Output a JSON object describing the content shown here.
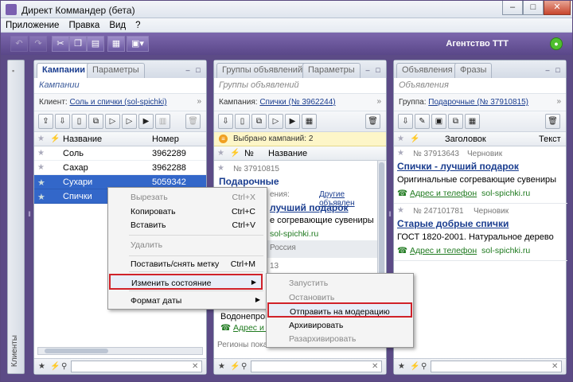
{
  "window": {
    "title": "Директ Коммандер (бета)"
  },
  "menu": [
    "Приложение",
    "Правка",
    "Вид",
    "?"
  ],
  "toolbar": {
    "agency": "Агентство ТТТ"
  },
  "side_strip": {
    "label": "Клиенты"
  },
  "panel1": {
    "tabs": [
      "Кампании",
      "Параметры"
    ],
    "subtitle": "Кампании",
    "filter_label": "Клиент:",
    "filter_value": "Соль и спички (sol-spichki)",
    "columns": [
      "Название",
      "Номер"
    ],
    "rows": [
      {
        "name": "Соль",
        "number": "3962289",
        "selected": false
      },
      {
        "name": "Сахар",
        "number": "3962288",
        "selected": false
      },
      {
        "name": "Сухари",
        "number": "5059342",
        "selected": true
      },
      {
        "name": "Спички",
        "number": "3962244",
        "selected": true
      }
    ]
  },
  "panel2": {
    "tabs": [
      "Группы объявлений",
      "Параметры"
    ],
    "subtitle": "Группы объявлений",
    "filter_label": "Кампания:",
    "filter_value": "Спички (№ 3962244)",
    "warning": "Выбрано кампаний: 2",
    "columns": [
      "№",
      "Название"
    ],
    "group_id": "№ 37910815",
    "group_name": "Подарочные",
    "hidden_partial": "ения:",
    "other_ads": "Другие объявлен",
    "ad_title_partial": "лучший подарок",
    "ad_text_partial": "е согревающие сувениры",
    "ad_url": "sol-spichki.ru",
    "region_partial": "Россия",
    "num_partial": "13",
    "text_partial": "Водонепрон",
    "contact_partial": "Адрес и те",
    "regions_partial": "Регионы показа"
  },
  "panel3": {
    "tabs": [
      "Объявления",
      "Фразы"
    ],
    "subtitle": "Объявления",
    "filter_label": "Группа:",
    "filter_value": "Подарочные (№ 37910815)",
    "columns": [
      "Заголовок",
      "Текст"
    ],
    "ads": [
      {
        "id": "№ 37913643",
        "status": "Черновик",
        "title": "Спички - лучший подарок",
        "text": "Оригинальные согревающие сувениры",
        "contact": "Адрес и телефон",
        "url": "sol-spichki.ru"
      },
      {
        "id": "№ 247101781",
        "status": "Черновик",
        "title": "Старые добрые спички",
        "text": "ГОСТ 1820-2001. Натуральное дерево",
        "contact": "Адрес и телефон",
        "url": "sol-spichki.ru"
      }
    ]
  },
  "context_menu": {
    "items": [
      {
        "label": "Вырезать",
        "shortcut": "Ctrl+X",
        "disabled": true
      },
      {
        "label": "Копировать",
        "shortcut": "Ctrl+C",
        "disabled": false
      },
      {
        "label": "Вставить",
        "shortcut": "Ctrl+V",
        "disabled": false
      },
      {
        "label": "Удалить",
        "shortcut": "",
        "disabled": true
      },
      {
        "label": "Поставить/снять метку",
        "shortcut": "Ctrl+M",
        "disabled": false
      },
      {
        "label": "Изменить состояние",
        "shortcut": "",
        "disabled": false,
        "highlighted": true
      },
      {
        "label": "Формат даты",
        "shortcut": "",
        "disabled": false
      }
    ]
  },
  "submenu": {
    "items": [
      {
        "label": "Запустить",
        "disabled": true
      },
      {
        "label": "Остановить",
        "disabled": true
      },
      {
        "label": "Отправить на модерацию",
        "disabled": false,
        "highlighted": true
      },
      {
        "label": "Архивировать",
        "disabled": false
      },
      {
        "label": "Разархивировать",
        "disabled": true
      }
    ]
  }
}
